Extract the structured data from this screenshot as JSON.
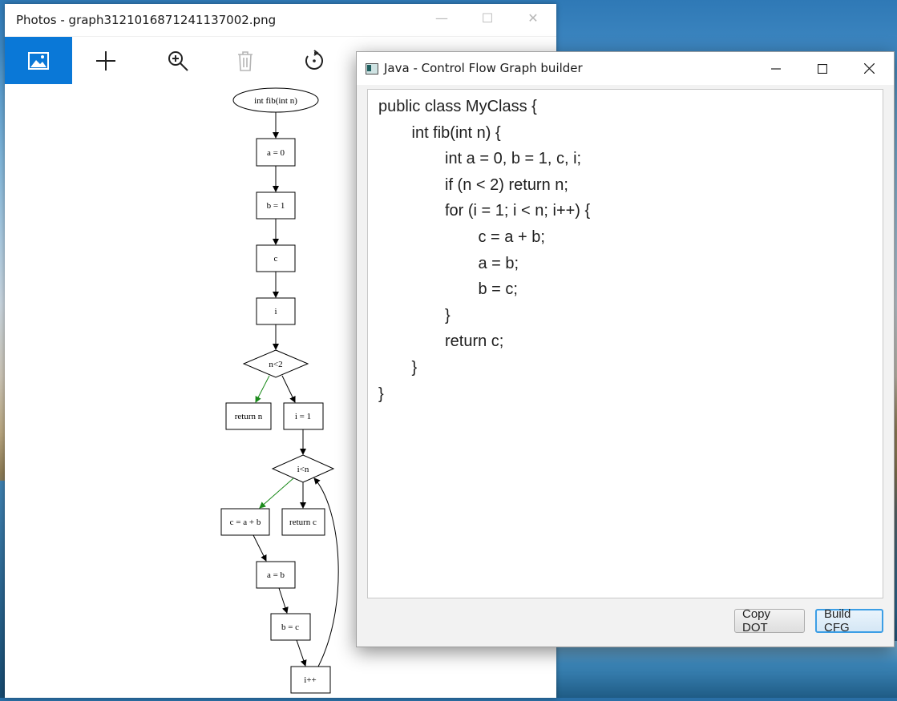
{
  "photos_window": {
    "title": "Photos - graph3121016871241137002.png",
    "controls": {
      "minimize": "—",
      "maximize": "☐",
      "close": "✕"
    },
    "toolbar": [
      {
        "name": "view-image",
        "icon": "image-icon"
      },
      {
        "name": "add",
        "icon": "plus-icon"
      },
      {
        "name": "zoom",
        "icon": "zoom-in-icon"
      },
      {
        "name": "delete",
        "icon": "trash-icon"
      },
      {
        "name": "rotate",
        "icon": "rotate-icon"
      }
    ],
    "graph": {
      "nodes": [
        {
          "id": "start",
          "label": "int fib(int n)",
          "shape": "ellipse"
        },
        {
          "id": "a0",
          "label": "a = 0",
          "shape": "box"
        },
        {
          "id": "b1",
          "label": "b = 1",
          "shape": "box"
        },
        {
          "id": "c",
          "label": "c",
          "shape": "box"
        },
        {
          "id": "i",
          "label": "i",
          "shape": "box"
        },
        {
          "id": "n2",
          "label": "n<2",
          "shape": "diamond"
        },
        {
          "id": "retn",
          "label": "return n",
          "shape": "box"
        },
        {
          "id": "i1",
          "label": "i = 1",
          "shape": "box"
        },
        {
          "id": "in",
          "label": "i<n",
          "shape": "diamond"
        },
        {
          "id": "cab",
          "label": "c = a + b",
          "shape": "box"
        },
        {
          "id": "retc",
          "label": "return c",
          "shape": "box"
        },
        {
          "id": "ab",
          "label": "a = b",
          "shape": "box"
        },
        {
          "id": "bc",
          "label": "b = c",
          "shape": "box"
        },
        {
          "id": "ipp",
          "label": "i++",
          "shape": "box"
        }
      ],
      "true_edge_color": "#1a8a1a",
      "edge_color": "#000000"
    }
  },
  "java_window": {
    "title": "Java - Control Flow Graph builder",
    "controls": {
      "minimize": "—",
      "maximize": "☐",
      "close": "✕"
    },
    "code_lines": [
      {
        "indent": 0,
        "text": "public class MyClass {"
      },
      {
        "indent": 1,
        "text": "int fib(int n) {"
      },
      {
        "indent": 2,
        "text": "int a = 0, b = 1, c, i;"
      },
      {
        "indent": 2,
        "text": "if (n < 2) return n;"
      },
      {
        "indent": 2,
        "text": "for (i = 1; i < n; i++) {"
      },
      {
        "indent": 3,
        "text": "c = a + b;"
      },
      {
        "indent": 3,
        "text": "a = b;"
      },
      {
        "indent": 3,
        "text": "b = c;"
      },
      {
        "indent": 2,
        "text": "}"
      },
      {
        "indent": 2,
        "text": "return c;"
      },
      {
        "indent": 1,
        "text": "}"
      },
      {
        "indent": 0,
        "text": "}"
      }
    ],
    "buttons": {
      "copy_dot": "Copy DOT",
      "build_cfg": "Build CFG"
    }
  }
}
